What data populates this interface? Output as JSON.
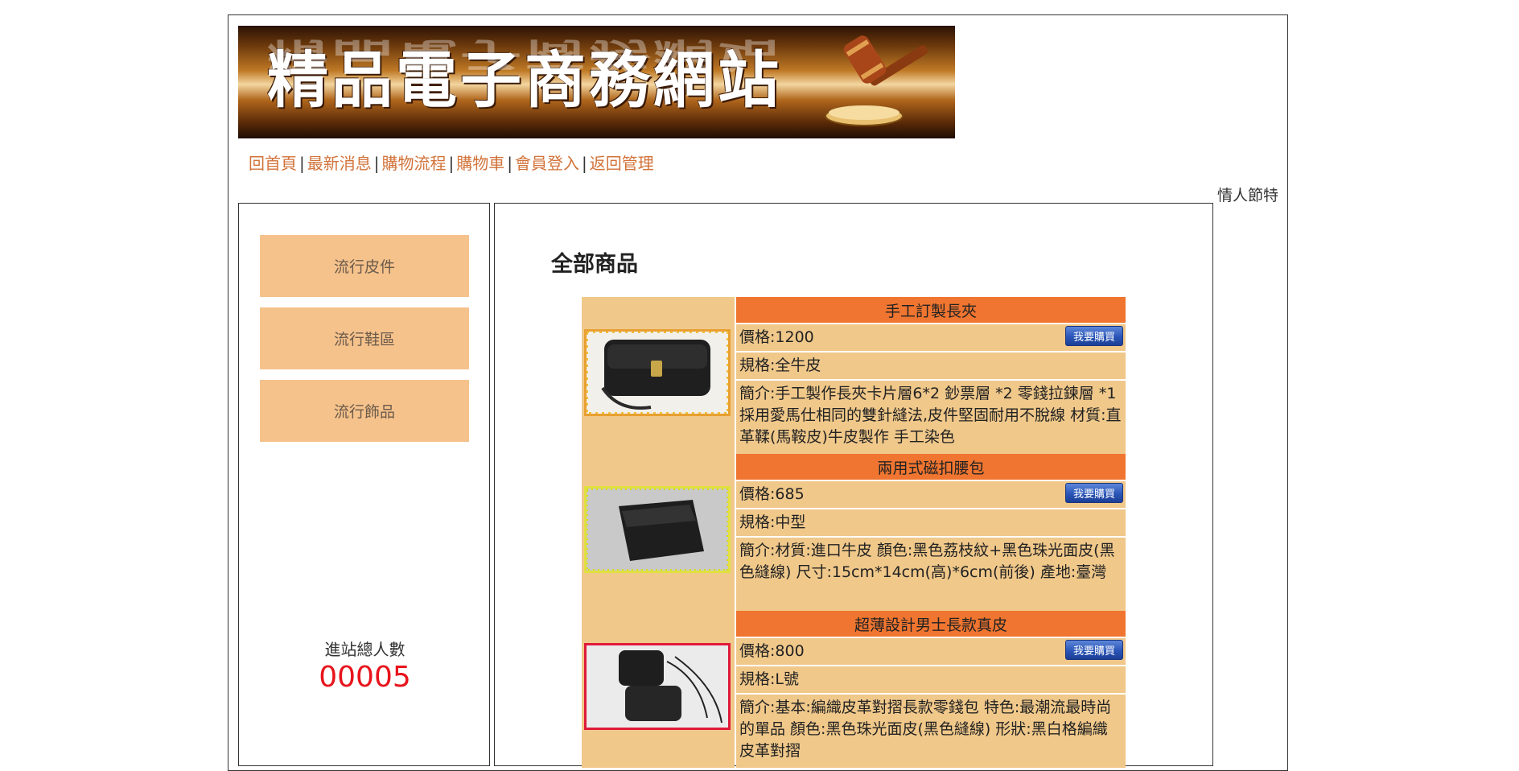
{
  "banner": {
    "title": "精品電子商務網站",
    "reflection": "精品電子商務網站"
  },
  "nav": {
    "items": [
      "回首頁",
      "最新消息",
      "購物流程",
      "購物車",
      "會員登入",
      "返回管理"
    ],
    "separator": "|"
  },
  "marquee": {
    "text": "情人節特"
  },
  "sidebar": {
    "categories": [
      "流行皮件",
      "流行鞋區",
      "流行飾品"
    ],
    "counter_label": "進站總人數",
    "counter_value": "00005"
  },
  "main": {
    "title": "全部商品",
    "buy_label": "我要購買",
    "products": [
      {
        "name": "手工訂製長夾",
        "price": "價格:1200",
        "spec": "規格:全牛皮",
        "desc": "簡介:手工製作長夾卡片層6*2 鈔票層 *2 零錢拉鍊層 *1 採用愛馬仕相同的雙針縫法,皮件堅固耐用不脫線 材質:直革鞣(馬鞍皮)牛皮製作 手工染色"
      },
      {
        "name": "兩用式磁扣腰包",
        "price": "價格:685",
        "spec": "規格:中型",
        "desc": "簡介:材質:進口牛皮 顏色:黑色荔枝紋+黑色珠光面皮(黑色縫線) 尺寸:15cm*14cm(高)*6cm(前後) 產地:臺灣"
      },
      {
        "name": "超薄設計男士長款真皮",
        "price": "價格:800",
        "spec": "規格:L號",
        "desc": "簡介:基本:編織皮革對摺長款零錢包 特色:最潮流最時尚的單品 顏色:黑色珠光面皮(黑色縫線) 形狀:黑白格編織皮革對摺"
      }
    ]
  },
  "colors": {
    "nav_link": "#d2733a",
    "category_bg": "#f5c28c",
    "product_header": "#f07530",
    "product_row": "#f0c88a",
    "counter": "#e8141c"
  }
}
